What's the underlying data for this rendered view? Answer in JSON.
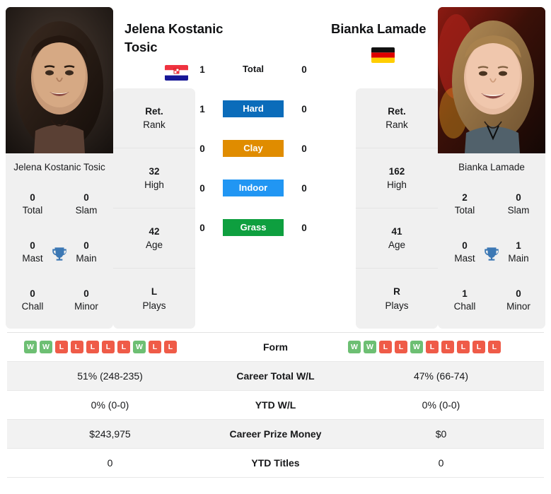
{
  "players": [
    {
      "full_name": "Jelena Kostanic Tosic",
      "header_name": "Jelena Kostanic Tosic",
      "card_name": "Jelena Kostanic Tosic",
      "country": "Croatia",
      "flag_icon": "flag-croatia",
      "photo_icon": "player-photo-jelena-kostanic-tosic",
      "titles": [
        {
          "value": "0",
          "label": "Total"
        },
        {
          "value": "0",
          "label": "Slam"
        },
        {
          "value": "0",
          "label": "Mast"
        },
        {
          "value": "0",
          "label": "Main"
        },
        {
          "value": "0",
          "label": "Chall"
        },
        {
          "value": "0",
          "label": "Minor"
        }
      ],
      "info": [
        {
          "value": "Ret.",
          "label": "Rank"
        },
        {
          "value": "32",
          "label": "High"
        },
        {
          "value": "42",
          "label": "Age"
        },
        {
          "value": "L",
          "label": "Plays"
        }
      ],
      "form": [
        "W",
        "W",
        "L",
        "L",
        "L",
        "L",
        "L",
        "W",
        "L",
        "L"
      ],
      "career_total_wl": "51% (248-235)",
      "ytd_wl": "0% (0-0)",
      "career_prize_money": "$243,975",
      "ytd_titles": "0"
    },
    {
      "full_name": "Bianka Lamade",
      "header_name": "Bianka Lamade",
      "card_name": "Bianka Lamade",
      "country": "Germany",
      "flag_icon": "flag-germany",
      "photo_icon": "player-photo-bianka-lamade",
      "titles": [
        {
          "value": "2",
          "label": "Total"
        },
        {
          "value": "0",
          "label": "Slam"
        },
        {
          "value": "0",
          "label": "Mast"
        },
        {
          "value": "1",
          "label": "Main"
        },
        {
          "value": "1",
          "label": "Chall"
        },
        {
          "value": "0",
          "label": "Minor"
        }
      ],
      "info": [
        {
          "value": "Ret.",
          "label": "Rank"
        },
        {
          "value": "162",
          "label": "High"
        },
        {
          "value": "41",
          "label": "Age"
        },
        {
          "value": "R",
          "label": "Plays"
        }
      ],
      "form": [
        "W",
        "W",
        "L",
        "L",
        "W",
        "L",
        "L",
        "L",
        "L",
        "L"
      ],
      "career_total_wl": "47% (66-74)",
      "ytd_wl": "0% (0-0)",
      "career_prize_money": "$0",
      "ytd_titles": "0"
    }
  ],
  "head_to_head": [
    {
      "label": "Total",
      "left": "1",
      "right": "0",
      "color": "",
      "style": "plain"
    },
    {
      "label": "Hard",
      "left": "1",
      "right": "0",
      "color": "#0b6cba",
      "style": "pill"
    },
    {
      "label": "Clay",
      "left": "0",
      "right": "0",
      "color": "#e08c00",
      "style": "pill"
    },
    {
      "label": "Indoor",
      "left": "0",
      "right": "0",
      "color": "#2196f3",
      "style": "pill"
    },
    {
      "label": "Grass",
      "left": "0",
      "right": "0",
      "color": "#0e9f3f",
      "style": "pill"
    }
  ],
  "stats_rows": [
    {
      "label": "Form",
      "left": "",
      "right": "",
      "type": "form"
    },
    {
      "label": "Career Total W/L",
      "left": "51% (248-235)",
      "right": "47% (66-74)",
      "type": "text"
    },
    {
      "label": "YTD W/L",
      "left": "0% (0-0)",
      "right": "0% (0-0)",
      "type": "text"
    },
    {
      "label": "Career Prize Money",
      "left": "$243,975",
      "right": "$0",
      "type": "text"
    },
    {
      "label": "YTD Titles",
      "left": "0",
      "right": "0",
      "type": "text"
    }
  ],
  "colors": {
    "hard": "#0b6cba",
    "clay": "#e08c00",
    "indoor": "#2196f3",
    "grass": "#0e9f3f",
    "win_badge": "#6dbf73",
    "loss_badge": "#ef5b48",
    "trophy": "#3c78b4",
    "card_bg": "#f0f0f0"
  }
}
